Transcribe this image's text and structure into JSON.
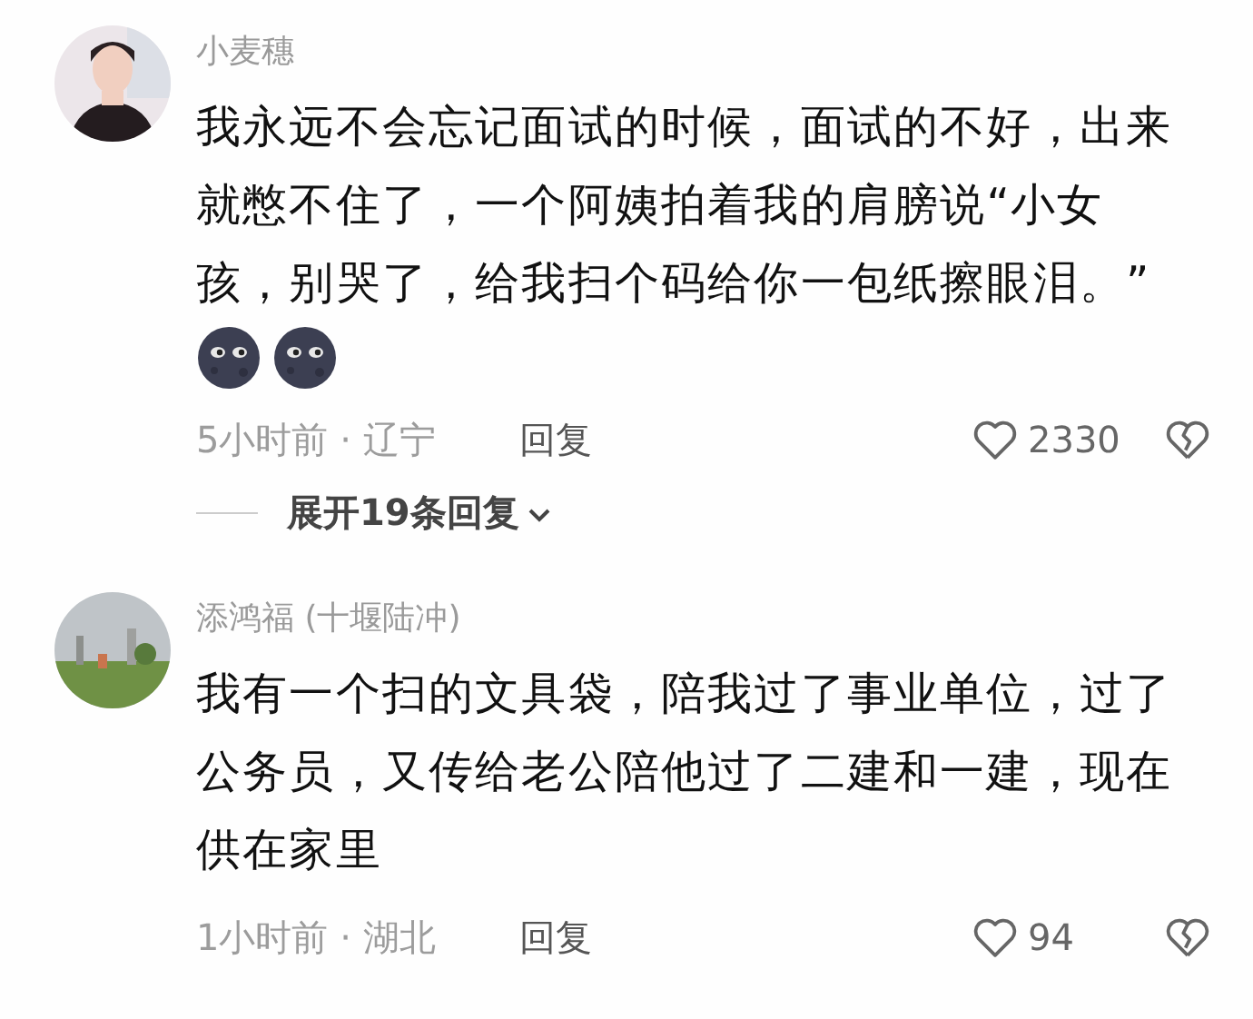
{
  "comments": [
    {
      "name": "小麦穗",
      "text": "我永远不会忘记面试的时候，面试的不好，出来就憋不住了，一个阿姨拍着我的肩膀说“小女孩，别哭了，给我扫个码给你一包纸擦眼泪。”",
      "emojis": [
        {
          "kind": "emoji"
        },
        {
          "kind": "emoji"
        }
      ],
      "time_location": "5小时前 · 辽宁",
      "reply": "回复",
      "likes": "2330",
      "expand": "展开19条回复"
    },
    {
      "name": "添鸿福 (十堰陆冲)",
      "text": "我有一个扫的文具袋，陪我过了事业单位，过了公务员，又传给老公陪他过了二建和一建，现在供在家里",
      "time_location": "1小时前 · 湖北",
      "reply": "回复",
      "likes": "94"
    }
  ]
}
